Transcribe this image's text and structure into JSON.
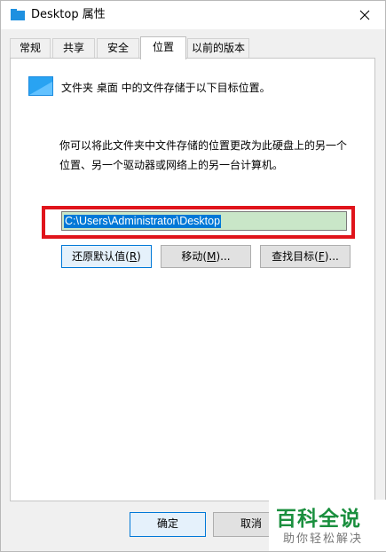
{
  "window": {
    "title": "Desktop 属性",
    "close_icon": "close-icon",
    "title_icon": "folder-icon"
  },
  "tabs": [
    {
      "label": "常规",
      "active": false
    },
    {
      "label": "共享",
      "active": false
    },
    {
      "label": "安全",
      "active": false
    },
    {
      "label": "位置",
      "active": true
    },
    {
      "label": "以前的版本",
      "active": false
    }
  ],
  "location": {
    "folder_description": "文件夹 桌面 中的文件存储于以下目标位置。",
    "info_line1": "你可以将此文件夹中文件存储的位置更改为此硬盘上的另一个",
    "info_line2": "位置、另一个驱动器或网络上的另一台计算机。",
    "path_value": "C:\\Users\\Administrator\\Desktop",
    "buttons": {
      "restore_default": {
        "text": "还原默认值(",
        "key": "R",
        "suffix": ")"
      },
      "move": {
        "text": "移动(",
        "key": "M",
        "suffix": ")..."
      },
      "find_target": {
        "text": "查找目标(",
        "key": "F",
        "suffix": ")..."
      }
    }
  },
  "dialog_buttons": {
    "ok": "确定",
    "cancel": "取消"
  },
  "watermark": {
    "logo": "百科全说",
    "subtitle": "助你轻松解决"
  },
  "colors": {
    "highlight_border": "#e0141b",
    "selection": "#0078d7",
    "input_bg": "#c9e6c8",
    "watermark_green": "#1a8f3e"
  }
}
